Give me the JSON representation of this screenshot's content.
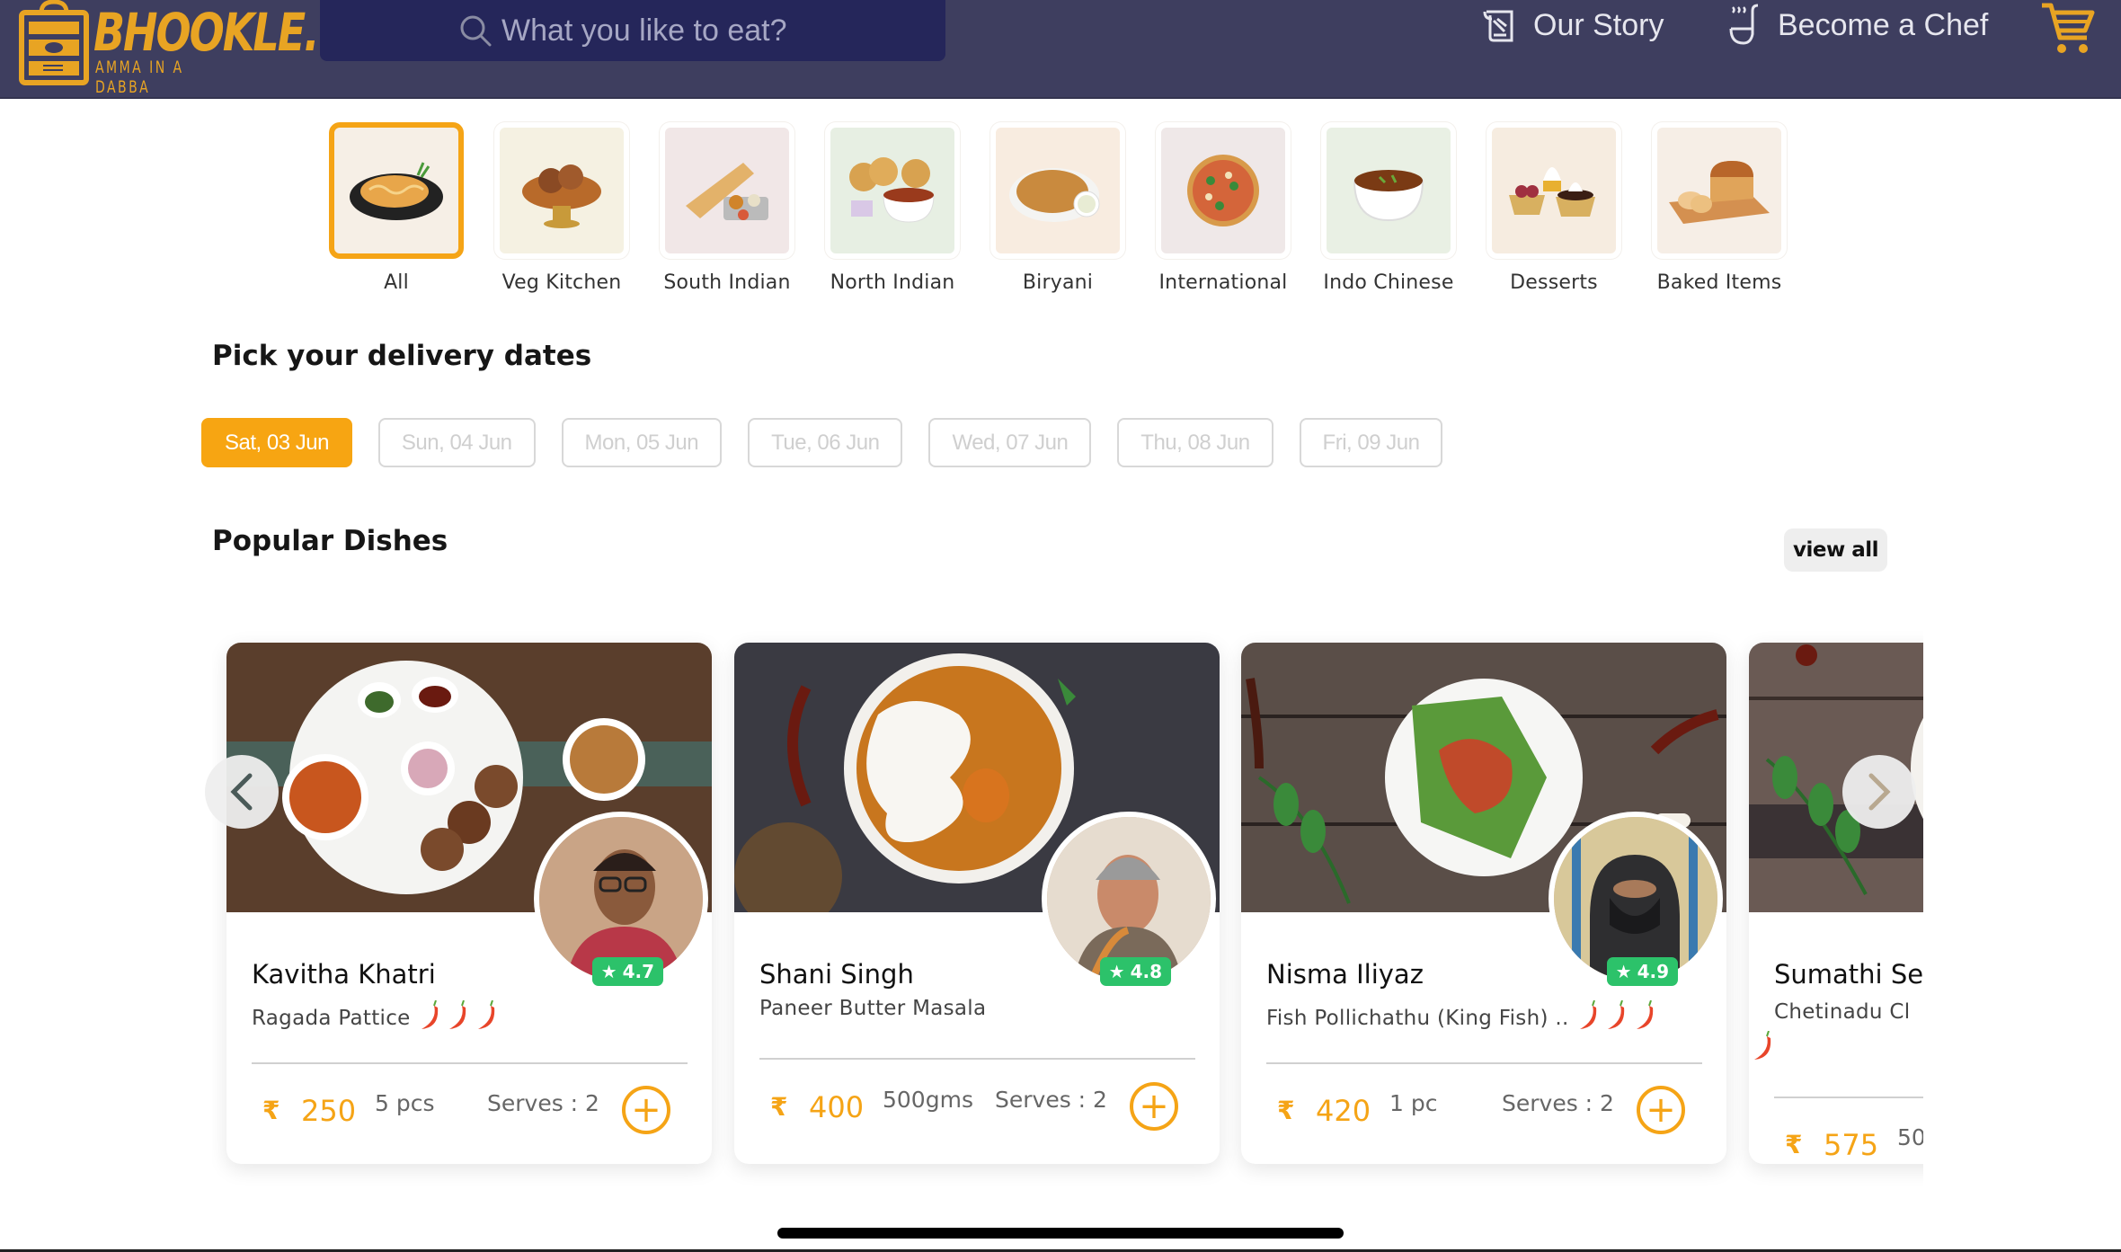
{
  "brand": {
    "name": "BHOOKLE.",
    "tagline": "AMMA IN A DABBA",
    "accent": "#e8a423"
  },
  "header": {
    "search_placeholder": "What you like to eat?",
    "nav": [
      {
        "label": "Our Story",
        "icon": "scroll-icon"
      },
      {
        "label": "Become a Chef",
        "icon": "ladle-icon"
      }
    ],
    "cart_icon": "cart-icon"
  },
  "categories": [
    {
      "label": "All",
      "active": true
    },
    {
      "label": "Veg Kitchen",
      "active": false
    },
    {
      "label": "South Indian",
      "active": false
    },
    {
      "label": "North Indian",
      "active": false
    },
    {
      "label": "Biryani",
      "active": false
    },
    {
      "label": "International",
      "active": false
    },
    {
      "label": "Indo Chinese",
      "active": false
    },
    {
      "label": "Desserts",
      "active": false
    },
    {
      "label": "Baked Items",
      "active": false
    }
  ],
  "delivery": {
    "title": "Pick your delivery dates",
    "dates": [
      {
        "label": "Sat, 03 Jun",
        "selected": true
      },
      {
        "label": "Sun, 04 Jun",
        "selected": false
      },
      {
        "label": "Mon, 05 Jun",
        "selected": false
      },
      {
        "label": "Tue, 06 Jun",
        "selected": false
      },
      {
        "label": "Wed, 07 Jun",
        "selected": false
      },
      {
        "label": "Thu, 08 Jun",
        "selected": false
      },
      {
        "label": "Fri, 09 Jun",
        "selected": false
      }
    ]
  },
  "popular": {
    "title": "Popular Dishes",
    "view_all": "view all",
    "currency": "₹",
    "dishes": [
      {
        "chef": "Kavitha Khatri",
        "dish": "Ragada Pattice",
        "spice_level": 3,
        "rating": "4.7",
        "price": "250",
        "quantity": "5 pcs",
        "serves": "Serves : 2",
        "add": "+"
      },
      {
        "chef": "Shani Singh",
        "dish": "Paneer Butter Masala",
        "spice_level": 0,
        "rating": "4.8",
        "price": "400",
        "quantity": "500gms",
        "serves": "Serves : 2",
        "add": "+"
      },
      {
        "chef": "Nisma Iliyaz",
        "dish": "Fish Pollichathu (King Fish) ..",
        "spice_level": 3,
        "rating": "4.9",
        "price": "420",
        "quantity": "1 pc",
        "serves": "Serves : 2",
        "add": "+"
      },
      {
        "chef": "Sumathi Se",
        "dish": "Chetinadu Cl",
        "spice_level": 1,
        "rating": "",
        "price": "575",
        "quantity": "50",
        "serves": "",
        "add": ""
      }
    ]
  },
  "colors": {
    "header_bg": "#3e3e5f",
    "search_bg": "#25265a",
    "primary": "#f5a416",
    "rating_green": "#2cc26a"
  }
}
